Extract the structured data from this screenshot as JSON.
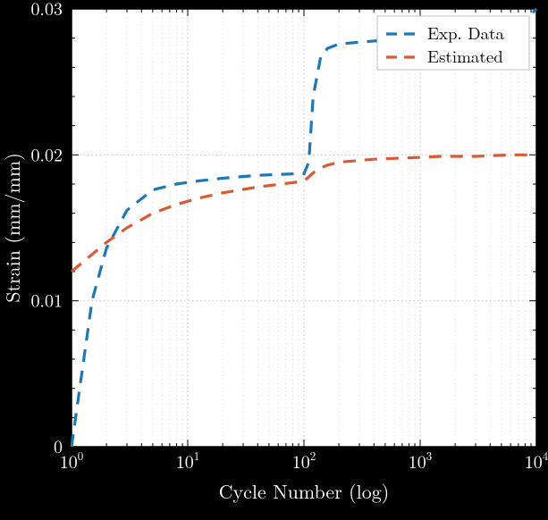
{
  "chart_data": {
    "type": "line",
    "xlabel": "Cycle Number (log)",
    "ylabel": "Strain (mm/mm)",
    "xscale": "log",
    "xlim": [
      1,
      10000
    ],
    "ylim": [
      0,
      0.03
    ],
    "x_major_ticks": [
      1,
      10,
      100,
      1000,
      10000
    ],
    "x_tick_labels": [
      "10^0",
      "10^1",
      "10^2",
      "10^3",
      "10^4"
    ],
    "y_major_ticks": [
      0,
      0.01,
      0.02,
      0.03
    ],
    "series": [
      {
        "name": "Exp. Data",
        "color": "#1f77b4",
        "dash": true,
        "data": [
          {
            "x": 1,
            "y": 0.0
          },
          {
            "x": 1.5,
            "y": 0.01
          },
          {
            "x": 2,
            "y": 0.0136
          },
          {
            "x": 3,
            "y": 0.0162
          },
          {
            "x": 5,
            "y": 0.0176
          },
          {
            "x": 8,
            "y": 0.018
          },
          {
            "x": 12,
            "y": 0.0182
          },
          {
            "x": 20,
            "y": 0.0184
          },
          {
            "x": 40,
            "y": 0.0186
          },
          {
            "x": 80,
            "y": 0.0187
          },
          {
            "x": 100,
            "y": 0.0187
          },
          {
            "x": 110,
            "y": 0.0195
          },
          {
            "x": 120,
            "y": 0.024
          },
          {
            "x": 140,
            "y": 0.0268
          },
          {
            "x": 160,
            "y": 0.0273
          },
          {
            "x": 200,
            "y": 0.0276
          },
          {
            "x": 400,
            "y": 0.0278
          },
          {
            "x": 800,
            "y": 0.0279
          },
          {
            "x": 1500,
            "y": 0.028
          },
          {
            "x": 3000,
            "y": 0.0282
          },
          {
            "x": 6000,
            "y": 0.0288
          },
          {
            "x": 8000,
            "y": 0.0292
          },
          {
            "x": 10000,
            "y": 0.03
          }
        ]
      },
      {
        "name": "Estimated",
        "color": "#d95b35",
        "dash": true,
        "data": [
          {
            "x": 1,
            "y": 0.012
          },
          {
            "x": 2,
            "y": 0.014
          },
          {
            "x": 3,
            "y": 0.015
          },
          {
            "x": 5,
            "y": 0.016
          },
          {
            "x": 8,
            "y": 0.0166
          },
          {
            "x": 12,
            "y": 0.017
          },
          {
            "x": 20,
            "y": 0.0174
          },
          {
            "x": 40,
            "y": 0.0178
          },
          {
            "x": 80,
            "y": 0.0181
          },
          {
            "x": 100,
            "y": 0.0182
          },
          {
            "x": 130,
            "y": 0.019
          },
          {
            "x": 160,
            "y": 0.0193
          },
          {
            "x": 200,
            "y": 0.0195
          },
          {
            "x": 400,
            "y": 0.0197
          },
          {
            "x": 800,
            "y": 0.0198
          },
          {
            "x": 1500,
            "y": 0.0199
          },
          {
            "x": 3000,
            "y": 0.0199
          },
          {
            "x": 6000,
            "y": 0.02
          },
          {
            "x": 10000,
            "y": 0.02
          }
        ]
      }
    ],
    "legend": {
      "position": "upper right"
    }
  },
  "legend_labels": {
    "exp": "Exp. Data",
    "est": "Estimated"
  },
  "axis_labels": {
    "x": "Cycle Number (log)",
    "y": "Strain (mm/mm)"
  },
  "y_tick_labels": {
    "0": "0",
    "0.01": "0.01",
    "0.02": "0.02",
    "0.03": "0.03"
  }
}
